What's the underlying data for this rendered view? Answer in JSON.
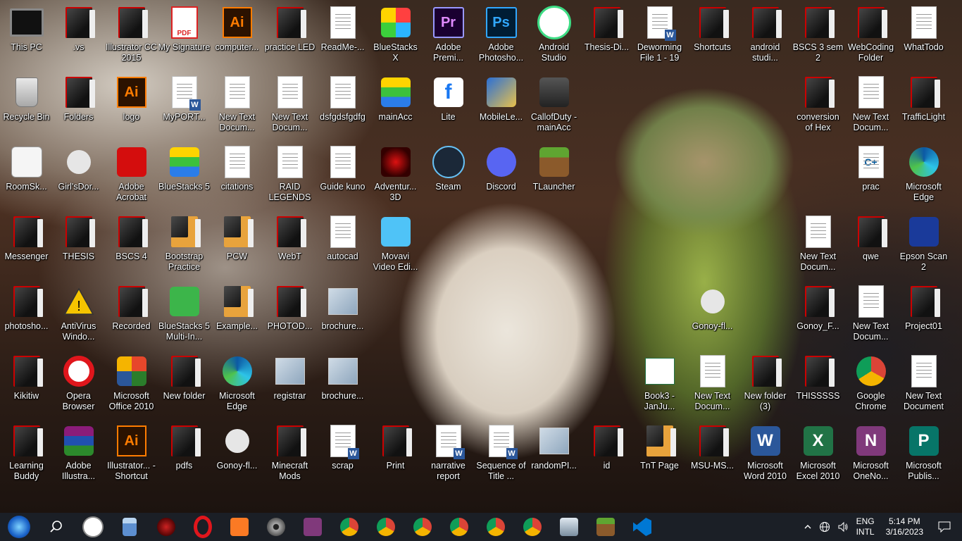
{
  "desktop": {
    "icons": [
      {
        "label": "This PC",
        "glyph": "computer-icon"
      },
      {
        "label": ".vs",
        "glyph": "folder-icon"
      },
      {
        "label": "Illustrator CC 2015",
        "glyph": "folder-icon"
      },
      {
        "label": "My Signature",
        "glyph": "pdf-icon"
      },
      {
        "label": "computer...",
        "glyph": "illustrator-file-icon"
      },
      {
        "label": "practice LED",
        "glyph": "folder-icon"
      },
      {
        "label": "ReadMe-...",
        "glyph": "text-file-icon"
      },
      {
        "label": "BlueStacks X",
        "glyph": "bluestacks-x-icon"
      },
      {
        "label": "Adobe Premi...",
        "glyph": "premiere-icon"
      },
      {
        "label": "Adobe Photosho...",
        "glyph": "photoshop-icon"
      },
      {
        "label": "Android Studio",
        "glyph": "android-studio-icon"
      },
      {
        "label": "Thesis-Di...",
        "glyph": "folder-icon"
      },
      {
        "label": "Deworming File 1 - 19",
        "glyph": "word-doc-icon"
      },
      {
        "label": "Shortcuts",
        "glyph": "folder-icon"
      },
      {
        "label": "android studi...",
        "glyph": "folder-icon"
      },
      {
        "label": "BSCS 3 sem 2",
        "glyph": "folder-icon"
      },
      {
        "label": "WebCoding Folder",
        "glyph": "folder-icon"
      },
      {
        "label": "WhatTodo",
        "glyph": "text-file-icon"
      },
      {
        "label": "Recycle Bin",
        "glyph": "recycle-bin-icon"
      },
      {
        "label": "Folders",
        "glyph": "folder-icon"
      },
      {
        "label": "logo",
        "glyph": "illustrator-file-icon"
      },
      {
        "label": "MyPORT...",
        "glyph": "word-doc-icon"
      },
      {
        "label": "New Text Docum...",
        "glyph": "text-file-icon"
      },
      {
        "label": "New Text Docum...",
        "glyph": "text-file-icon"
      },
      {
        "label": "dsfgdsfgdfg",
        "glyph": "text-file-icon"
      },
      {
        "label": "mainAcc",
        "glyph": "bluestacks-icon"
      },
      {
        "label": "Lite",
        "glyph": "facebook-lite-icon"
      },
      {
        "label": "MobileLe...",
        "glyph": "mobile-legends-icon"
      },
      {
        "label": "CallofDuty - mainAcc",
        "glyph": "call-of-duty-icon"
      },
      {
        "label": "conversion of Hex",
        "glyph": "folder-icon"
      },
      {
        "label": "New Text Docum...",
        "glyph": "text-file-icon"
      },
      {
        "label": "TrafficLight",
        "glyph": "folder-icon"
      },
      {
        "label": "RoomSk...",
        "glyph": "roomsketcher-icon"
      },
      {
        "label": "Girl'sDor...",
        "glyph": "gonoy-icon"
      },
      {
        "label": "Adobe Acrobat",
        "glyph": "acrobat-icon"
      },
      {
        "label": "BlueStacks 5",
        "glyph": "bluestacks-icon"
      },
      {
        "label": "citations",
        "glyph": "text-file-icon"
      },
      {
        "label": "RAID LEGENDS",
        "glyph": "text-file-icon"
      },
      {
        "label": "Guide kuno",
        "glyph": "text-file-icon"
      },
      {
        "label": "Adventur... 3D",
        "glyph": "game-dragon-icon"
      },
      {
        "label": "Steam",
        "glyph": "steam-icon"
      },
      {
        "label": "Discord",
        "glyph": "discord-icon"
      },
      {
        "label": "TLauncher",
        "glyph": "minecraft-icon"
      },
      {
        "label": "prac",
        "glyph": "cpp-file-icon"
      },
      {
        "label": "Microsoft Edge",
        "glyph": "edge-icon"
      },
      {
        "label": "Messenger",
        "glyph": "folder-icon"
      },
      {
        "label": "THESIS",
        "glyph": "folder-icon"
      },
      {
        "label": "BSCS 4",
        "glyph": "folder-icon"
      },
      {
        "label": "Bootstrap Practice",
        "glyph": "chrome-folder-icon"
      },
      {
        "label": "PCW",
        "glyph": "chrome-folder-icon"
      },
      {
        "label": "WebT",
        "glyph": "folder-icon"
      },
      {
        "label": "autocad",
        "glyph": "text-file-icon"
      },
      {
        "label": "Movavi Video Edi...",
        "glyph": "movavi-icon"
      },
      {
        "label": "New Text Docum...",
        "glyph": "text-file-icon"
      },
      {
        "label": "qwe",
        "glyph": "folder-icon"
      },
      {
        "label": "Epson Scan 2",
        "glyph": "epson-icon"
      },
      {
        "label": "photosho...",
        "glyph": "folder-icon"
      },
      {
        "label": "AntiVirus Windo...",
        "glyph": "warning-icon"
      },
      {
        "label": "Recorded",
        "glyph": "folder-icon"
      },
      {
        "label": "BlueStacks 5 Multi-In...",
        "glyph": "bluestacks-multi-icon"
      },
      {
        "label": "Example...",
        "glyph": "chrome-folder-icon"
      },
      {
        "label": "PHOTOD...",
        "glyph": "folder-icon"
      },
      {
        "label": "brochure...",
        "glyph": "image-file-icon"
      },
      {
        "label": "Gonoy-fl...",
        "glyph": "gonoy-icon"
      },
      {
        "label": "Gonoy_F...",
        "glyph": "folder-icon"
      },
      {
        "label": "New Text Docum...",
        "glyph": "text-file-icon"
      },
      {
        "label": "Project01",
        "glyph": "folder-icon"
      },
      {
        "label": "Kikitiw",
        "glyph": "folder-icon"
      },
      {
        "label": "Opera Browser",
        "glyph": "opera-icon"
      },
      {
        "label": "Microsoft Office 2010",
        "glyph": "office-icon"
      },
      {
        "label": "New folder",
        "glyph": "folder-icon"
      },
      {
        "label": "Microsoft Edge",
        "glyph": "edge-icon"
      },
      {
        "label": "registrar",
        "glyph": "image-file-icon"
      },
      {
        "label": "brochure...",
        "glyph": "image-file-icon"
      },
      {
        "label": "Book3 - JanJu...",
        "glyph": "excel-file-icon"
      },
      {
        "label": "New Text Docum...",
        "glyph": "text-file-icon"
      },
      {
        "label": "New folder (3)",
        "glyph": "folder-icon"
      },
      {
        "label": "THISSSSS",
        "glyph": "folder-icon"
      },
      {
        "label": "Google Chrome",
        "glyph": "chrome-icon"
      },
      {
        "label": "New Text Document",
        "glyph": "text-file-icon"
      },
      {
        "label": "Learning Buddy",
        "glyph": "folder-icon"
      },
      {
        "label": "Adobe Illustra...",
        "glyph": "winrar-icon"
      },
      {
        "label": "Illustrator... - Shortcut",
        "glyph": "illustrator-file-icon"
      },
      {
        "label": "pdfs",
        "glyph": "folder-icon"
      },
      {
        "label": "Gonoy-fl...",
        "glyph": "gonoy-icon"
      },
      {
        "label": "Minecraft Mods",
        "glyph": "folder-icon"
      },
      {
        "label": "scrap",
        "glyph": "word-doc-icon"
      },
      {
        "label": "Print",
        "glyph": "folder-icon"
      },
      {
        "label": "narrative report",
        "glyph": "word-doc-icon"
      },
      {
        "label": "Sequence of Title ...",
        "glyph": "word-doc-icon"
      },
      {
        "label": "randomPI...",
        "glyph": "image-file-icon"
      },
      {
        "label": "id",
        "glyph": "folder-icon"
      },
      {
        "label": "TnT Page",
        "glyph": "chrome-folder-icon"
      },
      {
        "label": "MSU-MS...",
        "glyph": "folder-icon"
      },
      {
        "label": "Microsoft Word 2010",
        "glyph": "word-icon"
      },
      {
        "label": "Microsoft Excel 2010",
        "glyph": "excel-icon"
      },
      {
        "label": "Microsoft OneNo...",
        "glyph": "onenote-icon"
      },
      {
        "label": "Microsoft Publis...",
        "glyph": "publisher-icon"
      }
    ]
  },
  "taskbar": {
    "items": [
      {
        "name": "start-button",
        "glyph": "windows-logo-icon"
      },
      {
        "name": "search-button",
        "glyph": "search-icon"
      },
      {
        "name": "clock-app",
        "glyph": "clock-icon"
      },
      {
        "name": "calculator-app",
        "glyph": "calculator-icon"
      },
      {
        "name": "game-app",
        "glyph": "game-icon"
      },
      {
        "name": "opera-app",
        "glyph": "opera-icon"
      },
      {
        "name": "xampp-app",
        "glyph": "xampp-icon"
      },
      {
        "name": "media-app",
        "glyph": "disc-icon"
      },
      {
        "name": "onenote-app",
        "glyph": "onenote-icon"
      },
      {
        "name": "chrome-1",
        "glyph": "chrome-icon"
      },
      {
        "name": "chrome-2",
        "glyph": "chrome-icon"
      },
      {
        "name": "chrome-3",
        "glyph": "chrome-icon"
      },
      {
        "name": "chrome-4",
        "glyph": "chrome-icon"
      },
      {
        "name": "chrome-5",
        "glyph": "chrome-icon"
      },
      {
        "name": "chrome-6",
        "glyph": "chrome-icon"
      },
      {
        "name": "monitor-app",
        "glyph": "monitor-icon"
      },
      {
        "name": "minecraft-app",
        "glyph": "minecraft-icon"
      },
      {
        "name": "vscode-app",
        "glyph": "vscode-icon"
      }
    ],
    "tray": {
      "lang_top": "ENG",
      "lang_bottom": "INTL",
      "time": "5:14 PM",
      "date": "3/16/2023"
    }
  },
  "colors": {
    "taskbar_bg": "#1b1f26",
    "folder_accent": "#cc0000",
    "label_text": "#ffffff"
  }
}
